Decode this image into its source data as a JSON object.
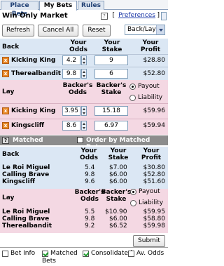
{
  "tabs": [
    {
      "label": "Place Bets",
      "active": false
    },
    {
      "label": "My Bets",
      "active": true
    },
    {
      "label": "Rules",
      "active": false
    }
  ],
  "market": {
    "title": "Win Only Market",
    "help": "?",
    "preferences": "Preferences",
    "bracket_open": "[",
    "bracket_close": "]"
  },
  "toolbar": {
    "refresh": "Refresh",
    "cancel_all": "Cancel All",
    "reset": "Reset",
    "view_select": "Back/Lay"
  },
  "unmatched": {
    "back": {
      "label": "Back",
      "col_odds": "Your Odds",
      "col_stake": "Your Stake",
      "col_profit": "Your Profit",
      "rows": [
        {
          "name": "Kicking King",
          "odds": "4.2",
          "stake": "9",
          "profit": "$28.80"
        },
        {
          "name": "Therealbandit",
          "odds": "9.8",
          "stake": "6",
          "profit": "$52.80"
        }
      ]
    },
    "lay": {
      "label": "Lay",
      "col_odds": "Backer's Odds",
      "col_stake": "Backer's Stake",
      "radio_payout": "Payout",
      "radio_liability": "Liability",
      "rows": [
        {
          "name": "Kicking King",
          "odds": "3.95",
          "stake": "15.18",
          "profit": "$59.96"
        },
        {
          "name": "Kingscliff",
          "odds": "8.6",
          "stake": "6.97",
          "profit": "$59.94"
        }
      ]
    }
  },
  "matched": {
    "help": "?",
    "label": "Matched",
    "order_label": "Order by Matched Date",
    "back": {
      "label": "Back",
      "col_odds": "Your Odds",
      "col_stake": "Your Stake",
      "col_profit": "Your Profit",
      "rows": [
        {
          "name": "Le Roi Miguel",
          "odds": "5.4",
          "stake": "$7.00",
          "profit": "$30.80"
        },
        {
          "name": "Calling Brave",
          "odds": "9.8",
          "stake": "$6.00",
          "profit": "$52.80"
        },
        {
          "name": "Kingscliff",
          "odds": "9.6",
          "stake": "$6.00",
          "profit": "$51.60"
        }
      ]
    },
    "lay": {
      "label": "Lay",
      "col_odds": "Backer's Odds",
      "col_stake": "Backer's Stake",
      "radio_payout": "Payout",
      "radio_liability": "Liability",
      "rows": [
        {
          "name": "Le Roi Miguel",
          "odds": "5.5",
          "stake": "$10.90",
          "profit": "$59.95"
        },
        {
          "name": "Calling Brave",
          "odds": "9.8",
          "stake": "$6.00",
          "profit": "$58.80"
        },
        {
          "name": "Therealbandit",
          "odds": "9.2",
          "stake": "$6.52",
          "profit": "$59.98"
        }
      ]
    }
  },
  "submit": "Submit",
  "footer": {
    "bet_info": "Bet Info",
    "matched_bets_1": "Matched",
    "matched_bets_2": "Bets",
    "consolidated": "Consolidated",
    "av_odds": "Av. Odds"
  },
  "colors": {
    "back": "#dbe7f4",
    "lay": "#f4d8e3",
    "matched_bar": "#8c8c8c",
    "link": "#1d39a8"
  }
}
